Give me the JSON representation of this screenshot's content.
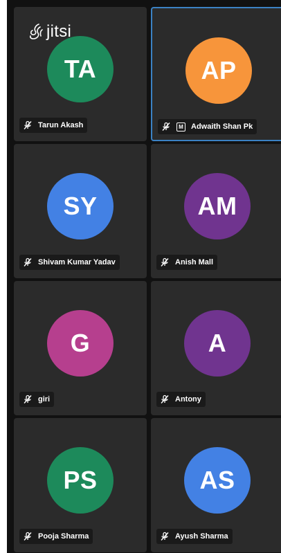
{
  "app": {
    "logo_text": "jitsi",
    "logo_icon": "jitsi-logo-icon"
  },
  "colors": {
    "tile_bg": "#2b2b2b",
    "active_border": "#3b82c4",
    "nameplate_bg": "#1a1a1a"
  },
  "participants": [
    {
      "initials": "TA",
      "name": "Tarun Akash",
      "color": "#1d8a5b",
      "muted": true,
      "moderator": false,
      "active": false
    },
    {
      "initials": "AP",
      "name": "Adwaith Shan Pk",
      "color": "#f7953b",
      "muted": true,
      "moderator": true,
      "moderator_badge": "M",
      "active": true
    },
    {
      "initials": "SY",
      "name": "Shivam Kumar Yadav",
      "color": "#4381e4",
      "muted": true,
      "moderator": false,
      "active": false
    },
    {
      "initials": "AM",
      "name": "Anish Mall",
      "color": "#70348f",
      "muted": true,
      "moderator": false,
      "active": false
    },
    {
      "initials": "G",
      "name": "giri",
      "color": "#b63f8e",
      "muted": true,
      "moderator": false,
      "active": false
    },
    {
      "initials": "A",
      "name": "Antony",
      "color": "#70348f",
      "muted": true,
      "moderator": false,
      "active": false
    },
    {
      "initials": "PS",
      "name": "Pooja Sharma",
      "color": "#1d8a5b",
      "muted": true,
      "moderator": false,
      "active": false
    },
    {
      "initials": "AS",
      "name": "Ayush Sharma",
      "color": "#4381e4",
      "muted": true,
      "moderator": false,
      "active": false
    }
  ]
}
